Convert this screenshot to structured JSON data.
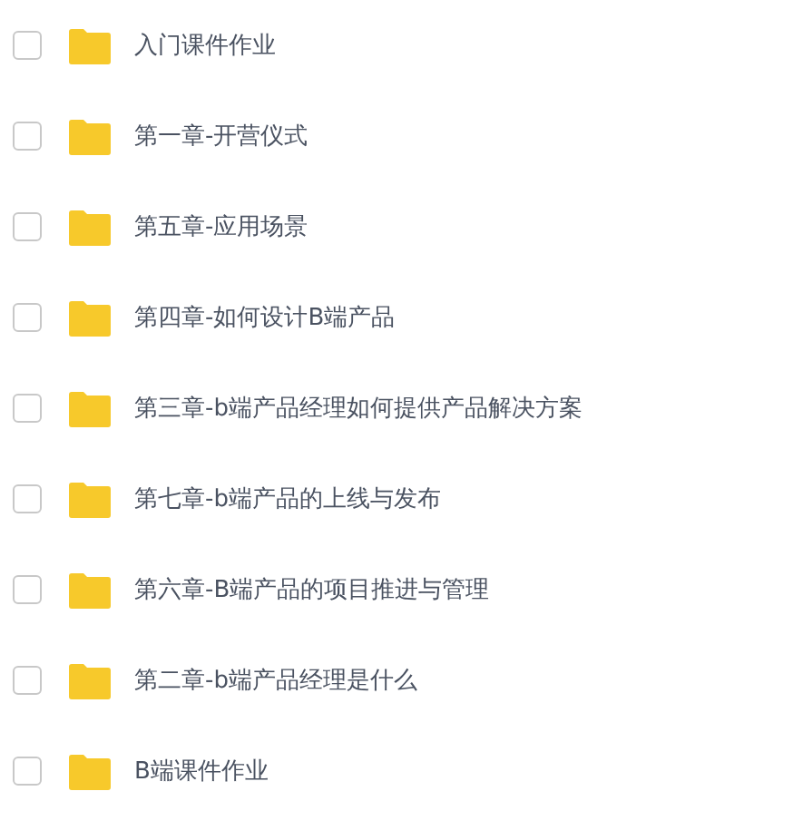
{
  "files": [
    {
      "name": "入门课件作业",
      "checked": false
    },
    {
      "name": "第一章-开营仪式",
      "checked": false
    },
    {
      "name": "第五章-应用场景",
      "checked": false
    },
    {
      "name": "第四章-如何设计B端产品",
      "checked": false
    },
    {
      "name": "第三章-b端产品经理如何提供产品解决方案",
      "checked": false
    },
    {
      "name": "第七章-b端产品的上线与发布",
      "checked": false
    },
    {
      "name": "第六章-B端产品的项目推进与管理",
      "checked": false
    },
    {
      "name": "第二章-b端产品经理是什么",
      "checked": false
    },
    {
      "name": "B端课件作业",
      "checked": false
    }
  ]
}
